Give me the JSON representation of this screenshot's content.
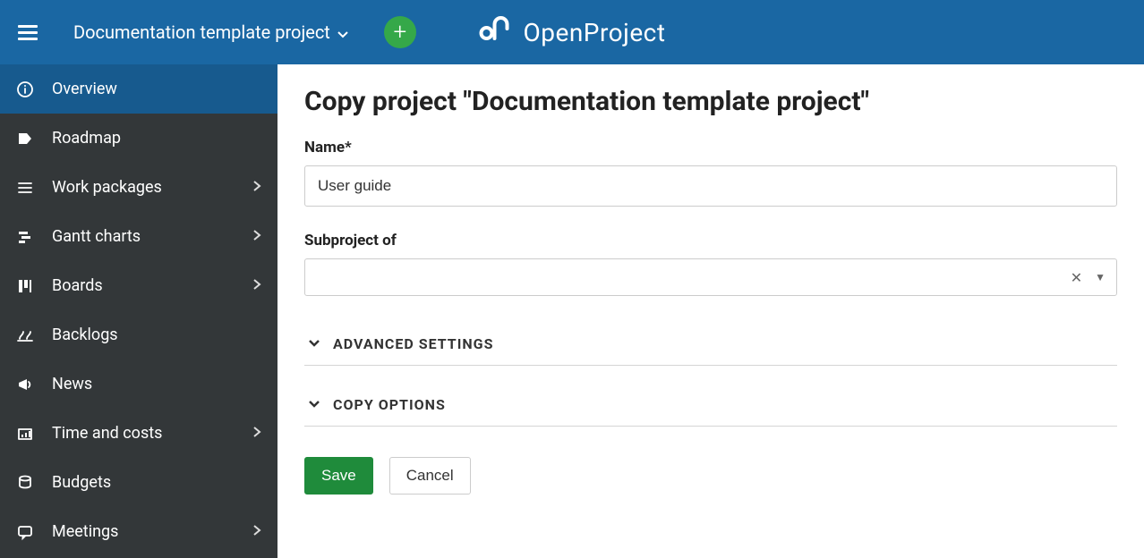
{
  "header": {
    "project_name": "Documentation template project",
    "brand": "OpenProject"
  },
  "sidebar": {
    "items": [
      {
        "label": "Overview",
        "icon": "info-icon",
        "active": true,
        "has_arrow": false
      },
      {
        "label": "Roadmap",
        "icon": "tag-icon",
        "active": false,
        "has_arrow": false
      },
      {
        "label": "Work packages",
        "icon": "list-icon",
        "active": false,
        "has_arrow": true
      },
      {
        "label": "Gantt charts",
        "icon": "gantt-icon",
        "active": false,
        "has_arrow": true
      },
      {
        "label": "Boards",
        "icon": "board-icon",
        "active": false,
        "has_arrow": true
      },
      {
        "label": "Backlogs",
        "icon": "backlog-icon",
        "active": false,
        "has_arrow": false
      },
      {
        "label": "News",
        "icon": "megaphone-icon",
        "active": false,
        "has_arrow": false
      },
      {
        "label": "Time and costs",
        "icon": "cost-icon",
        "active": false,
        "has_arrow": true
      },
      {
        "label": "Budgets",
        "icon": "budget-icon",
        "active": false,
        "has_arrow": false
      },
      {
        "label": "Meetings",
        "icon": "chat-icon",
        "active": false,
        "has_arrow": true
      }
    ]
  },
  "main": {
    "title": "Copy project \"Documentation template project\"",
    "name_label": "Name*",
    "name_value": "User guide",
    "subproject_label": "Subproject of",
    "subproject_value": "",
    "advanced_label": "Advanced settings",
    "copy_options_label": "Copy options",
    "save_label": "Save",
    "cancel_label": "Cancel"
  }
}
